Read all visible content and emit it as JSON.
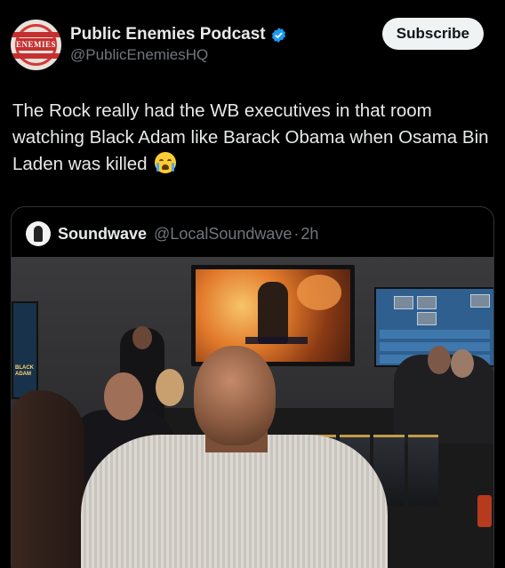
{
  "post": {
    "author_name": "Public Enemies Podcast",
    "author_handle": "@PublicEnemiesHQ",
    "avatar_text": "ENEMIES",
    "subscribe_label": "Subscribe",
    "text": "The Rock really had the WB executives in that room watching Black Adam like Barack Obama when Osama Bin Laden was killed"
  },
  "quote": {
    "author_name": "Soundwave",
    "author_handle": "@LocalSoundwave",
    "separator": "·",
    "time": "2h",
    "tv_left_label": "BLACK ADAM"
  },
  "colors": {
    "background": "#000000",
    "text": "#e7e9ea",
    "secondary_text": "#71767b",
    "verified": "#1d9bf0",
    "subscribe_bg": "#eff3f4"
  },
  "icons": {
    "verified": "verified-badge-icon",
    "emoji": "loudly-crying-face-emoji"
  }
}
